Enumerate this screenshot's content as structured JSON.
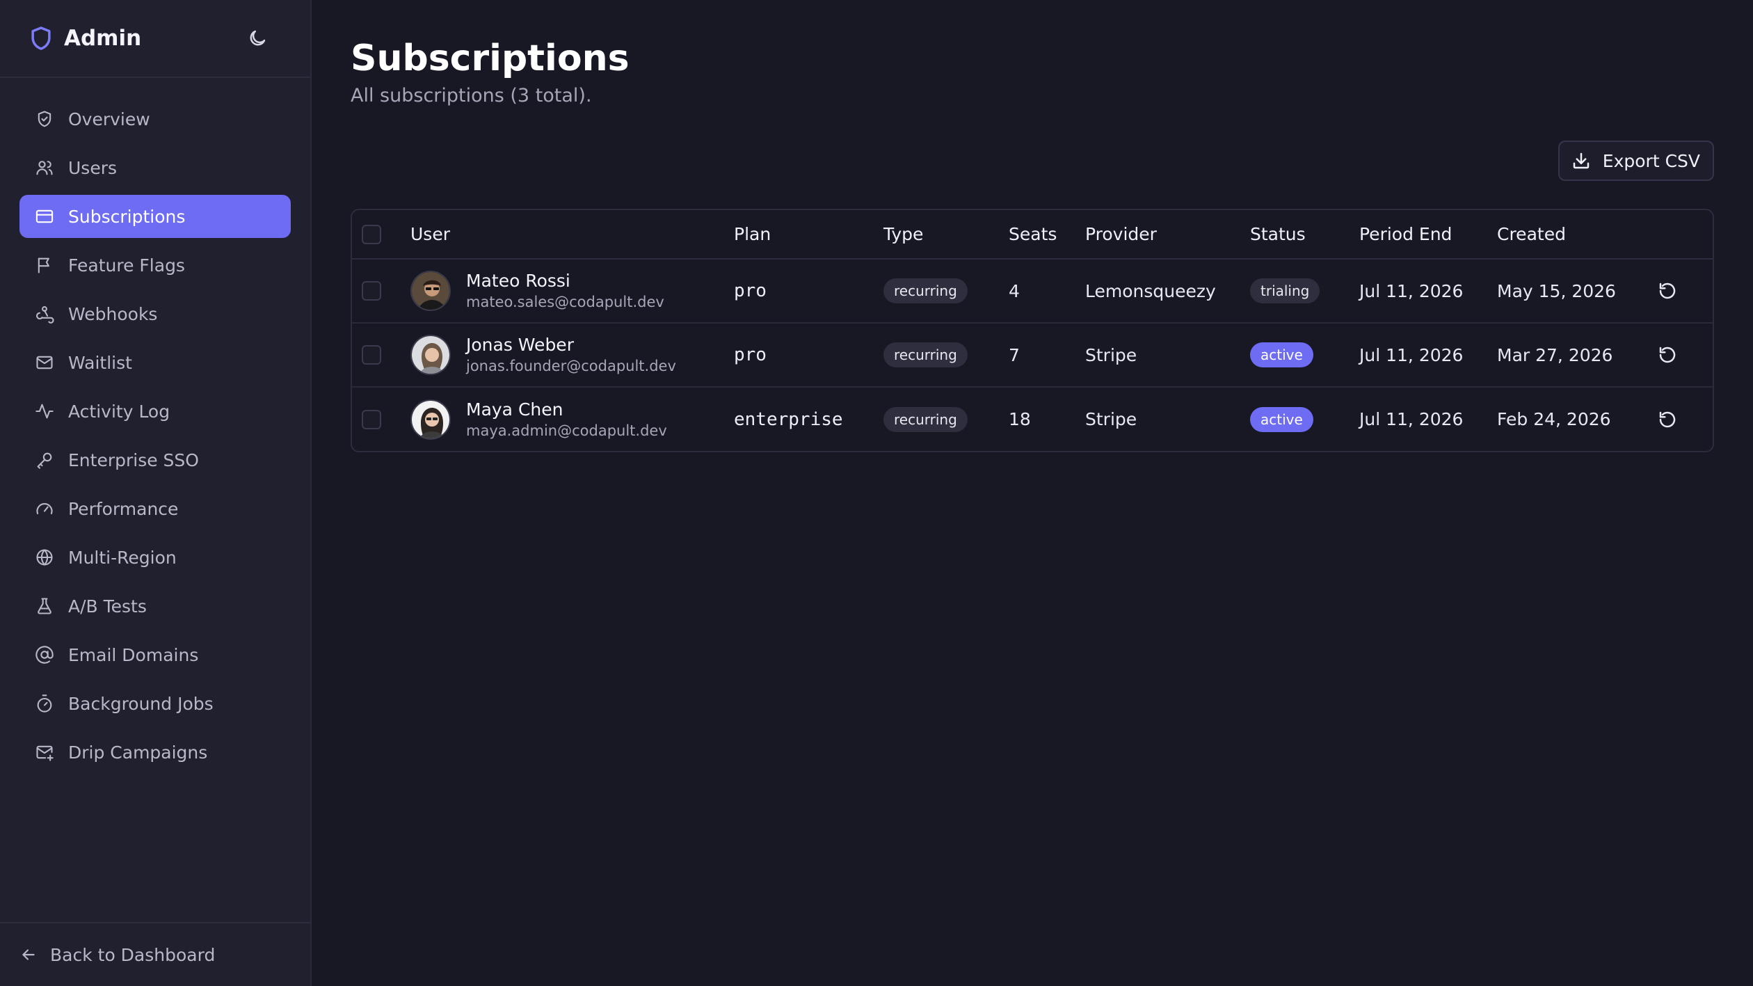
{
  "app": {
    "title": "Admin"
  },
  "sidebar": {
    "items": [
      {
        "label": "Overview",
        "icon": "shield-check-icon",
        "active": false
      },
      {
        "label": "Users",
        "icon": "users-icon",
        "active": false
      },
      {
        "label": "Subscriptions",
        "icon": "credit-card-icon",
        "active": true
      },
      {
        "label": "Feature Flags",
        "icon": "flag-icon",
        "active": false
      },
      {
        "label": "Webhooks",
        "icon": "webhook-icon",
        "active": false
      },
      {
        "label": "Waitlist",
        "icon": "mail-icon",
        "active": false
      },
      {
        "label": "Activity Log",
        "icon": "activity-icon",
        "active": false
      },
      {
        "label": "Enterprise SSO",
        "icon": "key-icon",
        "active": false
      },
      {
        "label": "Performance",
        "icon": "gauge-icon",
        "active": false
      },
      {
        "label": "Multi-Region",
        "icon": "globe-icon",
        "active": false
      },
      {
        "label": "A/B Tests",
        "icon": "flask-icon",
        "active": false
      },
      {
        "label": "Email Domains",
        "icon": "at-sign-icon",
        "active": false
      },
      {
        "label": "Background Jobs",
        "icon": "timer-icon",
        "active": false
      },
      {
        "label": "Drip Campaigns",
        "icon": "mail-plus-icon",
        "active": false
      }
    ],
    "footer_label": "Back to Dashboard"
  },
  "page": {
    "title": "Subscriptions",
    "subtitle": "All subscriptions (3 total).",
    "export_label": "Export CSV"
  },
  "table": {
    "columns": [
      "User",
      "Plan",
      "Type",
      "Seats",
      "Provider",
      "Status",
      "Period End",
      "Created"
    ],
    "rows": [
      {
        "name": "Mateo Rossi",
        "email": "mateo.sales@codapult.dev",
        "plan": "pro",
        "type": "recurring",
        "seats": "4",
        "provider": "Lemonsqueezy",
        "status": "trialing",
        "period_end": "Jul 11, 2026",
        "created": "May 15, 2026"
      },
      {
        "name": "Jonas Weber",
        "email": "jonas.founder@codapult.dev",
        "plan": "pro",
        "type": "recurring",
        "seats": "7",
        "provider": "Stripe",
        "status": "active",
        "period_end": "Jul 11, 2026",
        "created": "Mar 27, 2026"
      },
      {
        "name": "Maya Chen",
        "email": "maya.admin@codapult.dev",
        "plan": "enterprise",
        "type": "recurring",
        "seats": "18",
        "provider": "Stripe",
        "status": "active",
        "period_end": "Jul 11, 2026",
        "created": "Feb 24, 2026"
      }
    ]
  },
  "colors": {
    "accent": "#6d6cf2",
    "background": "#181825",
    "sidebar": "#20202e"
  }
}
